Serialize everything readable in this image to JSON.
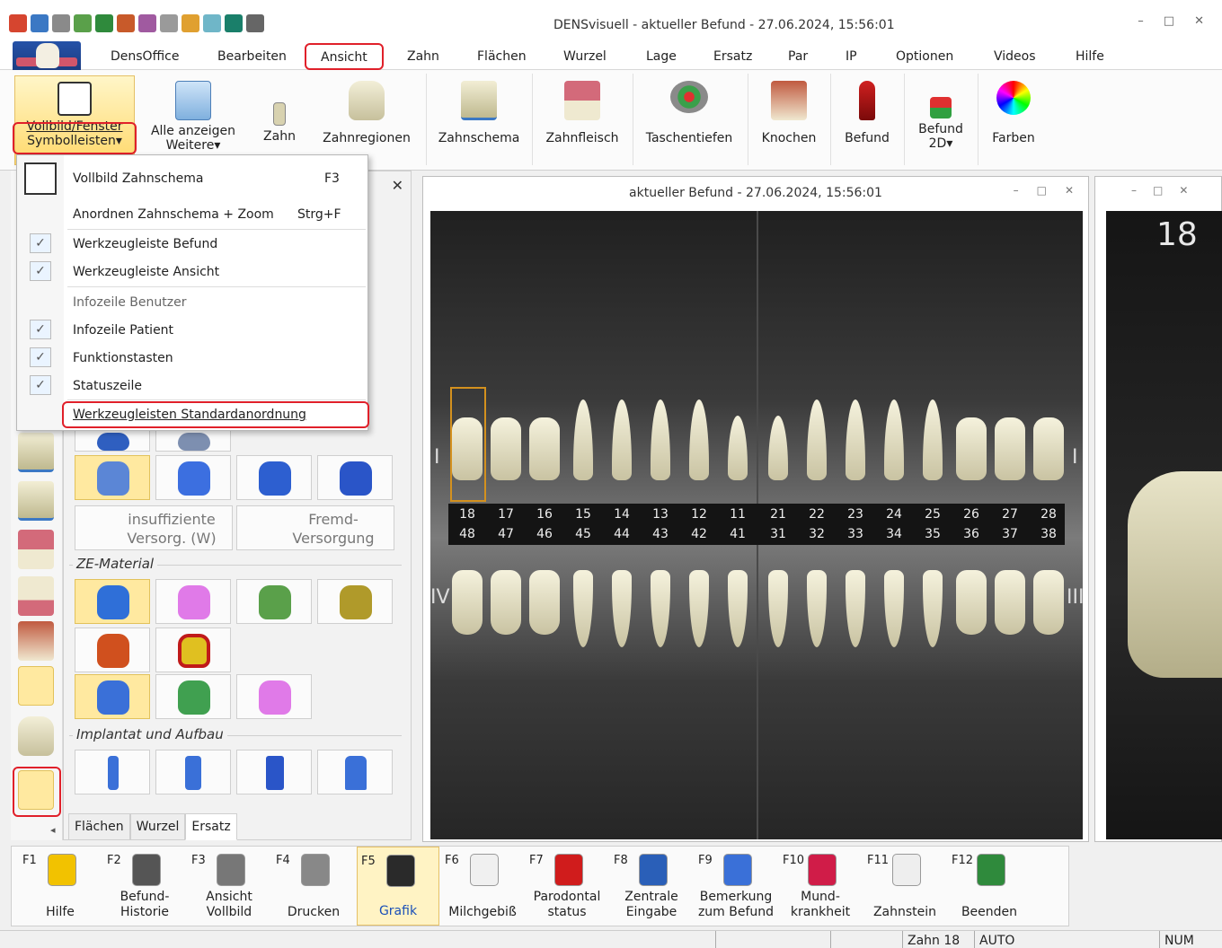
{
  "window": {
    "title": "DENSvisuell -  aktueller Befund - 27.06.2024, 15:56:01",
    "controls": [
      "–",
      "□",
      "✕"
    ]
  },
  "menu": {
    "items": [
      "DensOffice",
      "Bearbeiten",
      "Ansicht",
      "Zahn",
      "Flächen",
      "Wurzel",
      "Lage",
      "Ersatz",
      "Par",
      "IP",
      "Optionen",
      "Videos",
      "Hilfe"
    ]
  },
  "ribbon": {
    "vollbild": {
      "line1": "Vollbild/Fenster",
      "line2": "Symbolleisten▾"
    },
    "alle": {
      "line1": "Alle anzeigen",
      "line2": "Weitere▾"
    },
    "zahn": "Zahn",
    "zahnregionen": "Zahnregionen",
    "zahnschema": "Zahnschema",
    "zahnfleisch": "Zahnfleisch",
    "taschentiefen": "Taschentiefen",
    "knochen": "Knochen",
    "befund": "Befund",
    "befund2d": {
      "line1": "Befund",
      "line2": "2D▾"
    },
    "farben": "Farben"
  },
  "dropdown": {
    "items": [
      {
        "label": "Vollbild Zahnschema",
        "shortcut": "F3",
        "checked": false,
        "disabled": false
      },
      {
        "label": "Anordnen Zahnschema + Zoom",
        "shortcut": "Strg+F",
        "checked": false,
        "disabled": false
      },
      {
        "label": "Werkzeugleiste Befund",
        "shortcut": "",
        "checked": true,
        "disabled": false
      },
      {
        "label": "Werkzeugleiste Ansicht",
        "shortcut": "",
        "checked": true,
        "disabled": false
      },
      {
        "label": "Infozeile Benutzer",
        "shortcut": "",
        "checked": false,
        "disabled": true
      },
      {
        "label": "Infozeile Patient",
        "shortcut": "",
        "checked": true,
        "disabled": false
      },
      {
        "label": "Funktionstasten",
        "shortcut": "",
        "checked": true,
        "disabled": false
      },
      {
        "label": "Statuszeile",
        "shortcut": "",
        "checked": true,
        "disabled": false
      },
      {
        "label": "Werkzeugleisten Standardanordnung",
        "shortcut": "",
        "checked": false,
        "disabled": false
      }
    ],
    "check_mark": "✓"
  },
  "tools_panel": {
    "close": "✕",
    "insuff": {
      "line1": "insuffiziente",
      "line2": "Versorg. (W)"
    },
    "fremd": {
      "line1": "Fremd-",
      "line2": "Versorgung"
    },
    "group_ze": "ZE-Material",
    "group_impl": "Implantat und Aufbau",
    "tabs": [
      "Flächen",
      "Wurzel",
      "Ersatz"
    ],
    "collapse": "◂"
  },
  "doc": {
    "title": "aktueller Befund - 27.06.2024, 15:56:01",
    "upper_numbers": [
      "18",
      "17",
      "16",
      "15",
      "14",
      "13",
      "12",
      "11",
      "21",
      "22",
      "23",
      "24",
      "25",
      "26",
      "27",
      "28"
    ],
    "lower_numbers": [
      "48",
      "47",
      "46",
      "45",
      "44",
      "43",
      "42",
      "41",
      "31",
      "32",
      "33",
      "34",
      "35",
      "36",
      "37",
      "38"
    ],
    "quadrants": {
      "q1": "I",
      "q2": "I",
      "q3": "III",
      "q4": "IV"
    }
  },
  "right_view": {
    "tooth_number": "18"
  },
  "fkeys": [
    {
      "key": "F1",
      "line1": "",
      "line2": "Hilfe",
      "active": false
    },
    {
      "key": "F2",
      "line1": "Befund-",
      "line2": "Historie",
      "active": false
    },
    {
      "key": "F3",
      "line1": "Ansicht",
      "line2": "Vollbild",
      "active": false
    },
    {
      "key": "F4",
      "line1": "",
      "line2": "Drucken",
      "active": false
    },
    {
      "key": "F5",
      "line1": "",
      "line2": "Grafik",
      "active": true
    },
    {
      "key": "F6",
      "line1": "",
      "line2": "Milchgebiß",
      "active": false
    },
    {
      "key": "F7",
      "line1": "Parodontal",
      "line2": "status",
      "active": false
    },
    {
      "key": "F8",
      "line1": "Zentrale",
      "line2": "Eingabe",
      "active": false
    },
    {
      "key": "F9",
      "line1": "Bemerkung",
      "line2": "zum Befund",
      "active": false
    },
    {
      "key": "F10",
      "line1": "Mund-",
      "line2": "krankheit",
      "active": false
    },
    {
      "key": "F11",
      "line1": "",
      "line2": "Zahnstein",
      "active": false
    },
    {
      "key": "F12",
      "line1": "",
      "line2": "Beenden",
      "active": false
    }
  ],
  "statusbar": {
    "zahn": "Zahn 18",
    "mode": "AUTO",
    "num": "NUM"
  },
  "colors": {
    "highlight_red": "#e0202a",
    "selected_yellow": "#ffe9a0",
    "chart_bg": "#3a3a3a"
  }
}
